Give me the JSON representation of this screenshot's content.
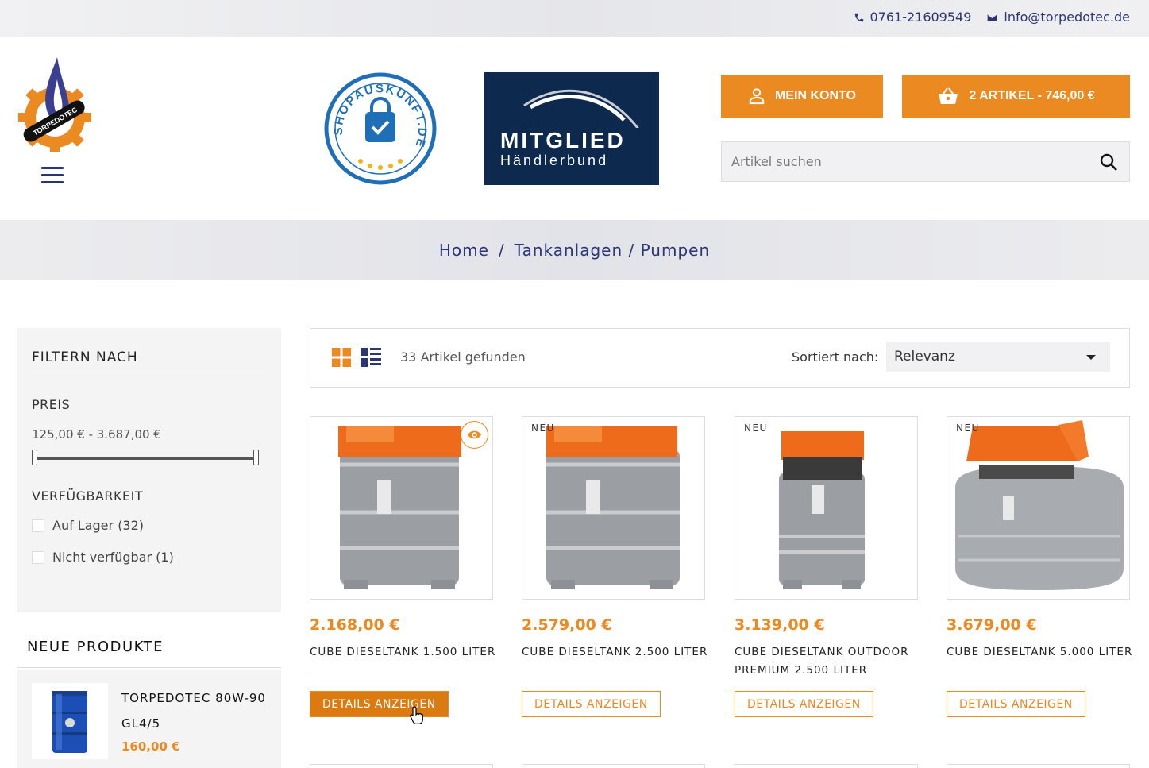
{
  "topbar": {
    "phone": "0761-21609549",
    "email": "info@torpedotec.de"
  },
  "header": {
    "logo_text": "TORPEDOTEC",
    "badge_shop_text": "SHOPAUSKUNFT.DE",
    "badge_member_line1": "MITGLIED",
    "badge_member_line2": "Händlerbund",
    "account_label": "MEIN KONTO",
    "cart_label": "2 ARTIKEL - 746,00 €",
    "search_placeholder": "Artikel suchen"
  },
  "breadcrumb": {
    "items": [
      "Home",
      "Tankanlagen / Pumpen"
    ],
    "separator": "/"
  },
  "filter": {
    "title": "FILTERN NACH",
    "price_label": "PREIS",
    "price_range": "125,00 € - 3.687,00 €",
    "price_min_fraction": 0,
    "price_max_fraction": 1,
    "availability_label": "VERFÜGBARKEIT",
    "options": [
      {
        "label": "Auf Lager (32)",
        "checked": false
      },
      {
        "label": "Nicht verfügbar (1)",
        "checked": false
      }
    ]
  },
  "new_products": {
    "title": "NEUE PRODUKTE",
    "items": [
      {
        "name": "TORPEDOTEC 80W-90 GL4/5",
        "price": "160,00 €"
      }
    ]
  },
  "toolbar": {
    "count": "33 Artikel gefunden",
    "sort_label": "Sortiert nach:",
    "sort_value": "Relevanz"
  },
  "products": [
    {
      "badge": "",
      "price": "2.168,00 €",
      "name": "CUBE DIESELTANK 1.500 LITER",
      "button": "DETAILS ANZEIGEN",
      "hovered": true
    },
    {
      "badge": "NEU",
      "price": "2.579,00 €",
      "name": "CUBE DIESELTANK 2.500 LITER",
      "button": "DETAILS ANZEIGEN",
      "hovered": false
    },
    {
      "badge": "NEU",
      "price": "3.139,00 €",
      "name": "CUBE DIESELTANK OUTDOOR PREMIUM 2.500 LITER",
      "button": "DETAILS ANZEIGEN",
      "hovered": false
    },
    {
      "badge": "NEU",
      "price": "3.679,00 €",
      "name": "CUBE DIESELTANK 5.000 LITER",
      "button": "DETAILS ANZEIGEN",
      "hovered": false
    }
  ],
  "colors": {
    "accent": "#ec8a22",
    "navy": "#2b3574",
    "member_bg": "#0d2a4e"
  }
}
